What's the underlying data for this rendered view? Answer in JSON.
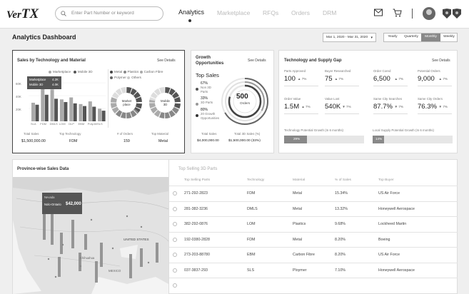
{
  "app": {
    "logo_main": "Ver",
    "logo_x": "TX"
  },
  "search": {
    "placeholder": "Enter Part Number or keyword"
  },
  "nav": {
    "items": [
      "Analytics",
      "Marketplace",
      "RFQs",
      "Orders",
      "DRM"
    ]
  },
  "header": {
    "title": "Analytics Dashboard",
    "date_range": "Mar 1, 2020 - Mar 31, 2020",
    "periods": [
      "Yearly",
      "Quarterly",
      "Monthly",
      "Weekly"
    ],
    "selected_period": "Monthly"
  },
  "sales_card": {
    "title": "Sales by Technology and Material",
    "see_details": "See Details",
    "bar_legend": [
      "Marketplace",
      "Mobile 3D"
    ],
    "yticks": [
      "60K",
      "40K",
      "20K"
    ],
    "tooltip": {
      "name1": "Marketplace",
      "val1": "4.2K",
      "name2": "Mobile 3D",
      "val2": "4.0K"
    },
    "bar_categories": [
      "SLA",
      "FDM",
      "DMLS",
      "LOM",
      "DLP",
      "EBM",
      "PolyJet",
      "SLS"
    ],
    "bar_values": [
      {
        "marketplace": 28,
        "mobile": 25
      },
      {
        "marketplace": 55,
        "mobile": 40
      },
      {
        "marketplace": 48,
        "mobile": 34
      },
      {
        "marketplace": 33,
        "mobile": 29
      },
      {
        "marketplace": 36,
        "mobile": 27
      },
      {
        "marketplace": 26,
        "mobile": 23
      },
      {
        "marketplace": 30,
        "mobile": 22
      },
      {
        "marketplace": 19,
        "mobile": 16
      }
    ],
    "material_legend": [
      "Metal",
      "Plastics",
      "Carbon Fibre",
      "Polymer",
      "Others"
    ],
    "donut1_label": "Market place",
    "donut2_label": "Mobile 3D",
    "footer": [
      {
        "label": "Total Sales",
        "value": "$1,500,000.00"
      },
      {
        "label": "Top Technology",
        "value": "FDM"
      },
      {
        "label": "# of Orders",
        "value": "159"
      },
      {
        "label": "Top Material",
        "value": "Metal"
      }
    ]
  },
  "growth_card": {
    "title_l1": "Growth",
    "title_l2": "Opportunities",
    "see_details": "See Details",
    "top_sales": "Top Sales",
    "items": [
      {
        "pct": "67%",
        "l1": "Non 3D",
        "l2": "Parts"
      },
      {
        "pct": "33%",
        "l1": "3D Parts",
        "l2": ""
      },
      {
        "pct": "80%",
        "l1": "20 Growth",
        "l2": "Opportunities"
      }
    ],
    "gauge_value": "500",
    "gauge_label": "Orders",
    "footer": [
      {
        "label": "Total Sales",
        "value": "$4,000,000.00"
      },
      {
        "label": "Total 3D Sales (%)",
        "value": "$1,500,000.00 (33%)"
      }
    ]
  },
  "tech_card": {
    "title": "Technology and Supply Gap",
    "see_details": "See Details",
    "metrics": [
      {
        "label": "Parts Approved",
        "value": "100",
        "delta": "7%",
        "up": true
      },
      {
        "label": "Buyer Researched",
        "value": "75",
        "delta": "7%",
        "up": true
      },
      {
        "label": "Order Cored",
        "value": "6,500",
        "delta": "7%",
        "up": true
      },
      {
        "label": "Potential Orders",
        "value": "9,000",
        "delta": "7%",
        "up": true
      },
      {
        "label": "Order Value",
        "value": "1.5M",
        "delta": "7%",
        "up": true
      },
      {
        "label": "Value Lost",
        "value": "540K",
        "delta": "7%",
        "up": false
      },
      {
        "label": "Same City Searches",
        "value": "87.7%",
        "delta": "7%",
        "up": false
      },
      {
        "label": "Same City Orders",
        "value": "76.3%",
        "delta": "7%",
        "up": false
      }
    ],
    "growth1": {
      "label": "Technology Potential Growth (In 6 months)",
      "pct": "29%",
      "fill": 0.29
    },
    "growth2": {
      "label": "Local Supply Potential Growth (In 6 months)",
      "pct": "14%",
      "fill": 0.14
    }
  },
  "map_card": {
    "title": "Province-wise Sales Data",
    "tooltip_region": "Nevada",
    "tooltip_region2": "Nolo-Ontario",
    "tooltip_value": "$42,000",
    "labels": [
      "UNITED STATES",
      "MEXICO",
      "Chihuahua"
    ]
  },
  "table": {
    "title": "Top Selling 3D Parts",
    "columns": [
      "Top Selling Parts",
      "Technology",
      "Material",
      "% of Sales",
      "Top Buyer"
    ],
    "rows": [
      [
        "271-292-2823",
        "FDM",
        "Metal",
        "15.34%",
        "US Air Force"
      ],
      [
        "281-382-3236",
        "DMLS",
        "Metal",
        "13.32%",
        "Honeywell Aerospace"
      ],
      [
        "382-292-0876",
        "LOM",
        "Plastics",
        "9.68%",
        "Lockheed Martin"
      ],
      [
        "192-0380-2828",
        "FDM",
        "Metal",
        "8.20%",
        "Boeing"
      ],
      [
        "273-203-88780",
        "EBM",
        "Carbon Fibre",
        "8.20%",
        "US Air Force"
      ],
      [
        "037-3837-293",
        "SLS",
        "Ploymer",
        "7.10%",
        "Honeywell Aerospace"
      ],
      [
        "",
        "",
        "",
        "",
        ""
      ]
    ]
  }
}
